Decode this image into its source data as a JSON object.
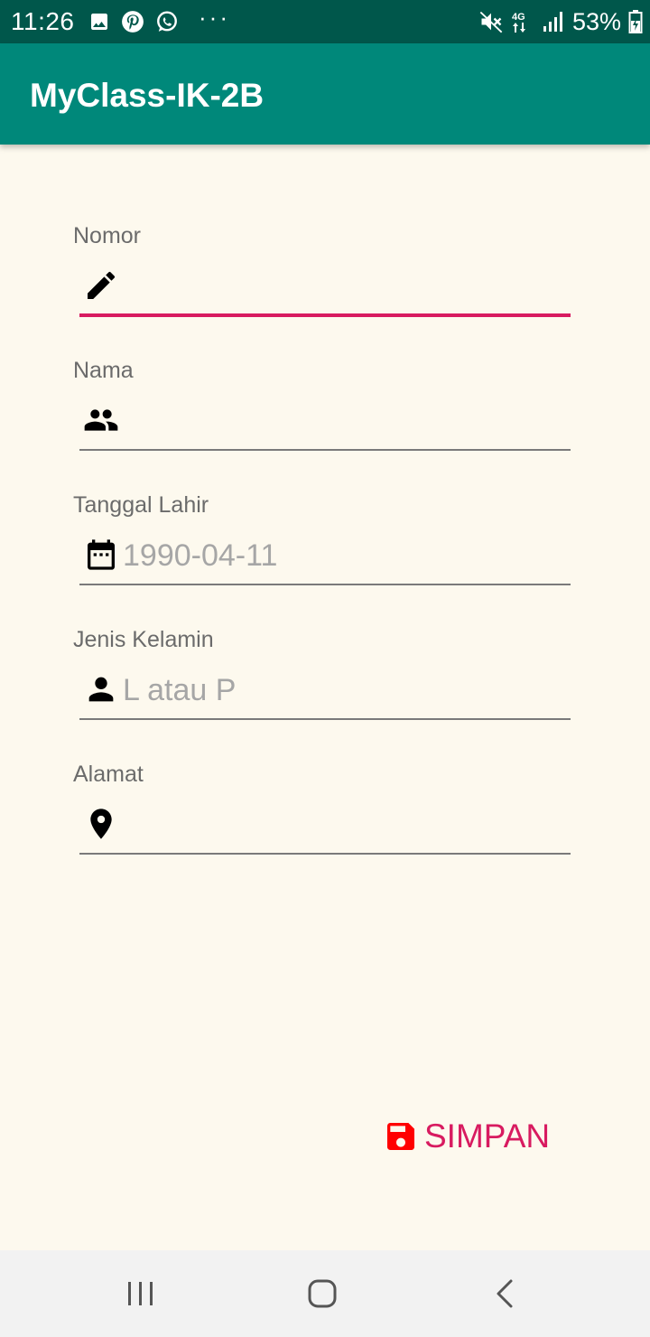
{
  "status_bar": {
    "time": "11:26",
    "left_icons": [
      "image-icon",
      "pinterest-icon",
      "whatsapp-icon"
    ],
    "more": "···",
    "right_icons": [
      "mute-icon",
      "network-4g-icon",
      "signal-icon"
    ],
    "battery": "53%"
  },
  "app_bar": {
    "title": "MyClass-IK-2B"
  },
  "form": {
    "fields": [
      {
        "label": "Nomor",
        "value": "",
        "icon": "edit-icon",
        "active": true
      },
      {
        "label": "Nama",
        "value": "",
        "icon": "people-icon",
        "active": false
      },
      {
        "label": "Tanggal Lahir",
        "value": "1990-04-11",
        "icon": "calendar-icon",
        "active": false
      },
      {
        "label": "Jenis Kelamin",
        "value": "L atau P",
        "icon": "person-icon",
        "active": false
      },
      {
        "label": "Alamat",
        "value": "",
        "icon": "location-pin-icon",
        "active": false
      }
    ]
  },
  "save_button": {
    "label": "SIMPAN",
    "icon": "save-icon"
  },
  "nav_bar": {
    "buttons": [
      "recent-apps-icon",
      "home-icon",
      "back-icon"
    ]
  },
  "colors": {
    "status_bar": "#00574b",
    "app_bar": "#00887a",
    "background": "#fdf9ee",
    "accent": "#d81b60",
    "save_icon": "#ff0000"
  }
}
